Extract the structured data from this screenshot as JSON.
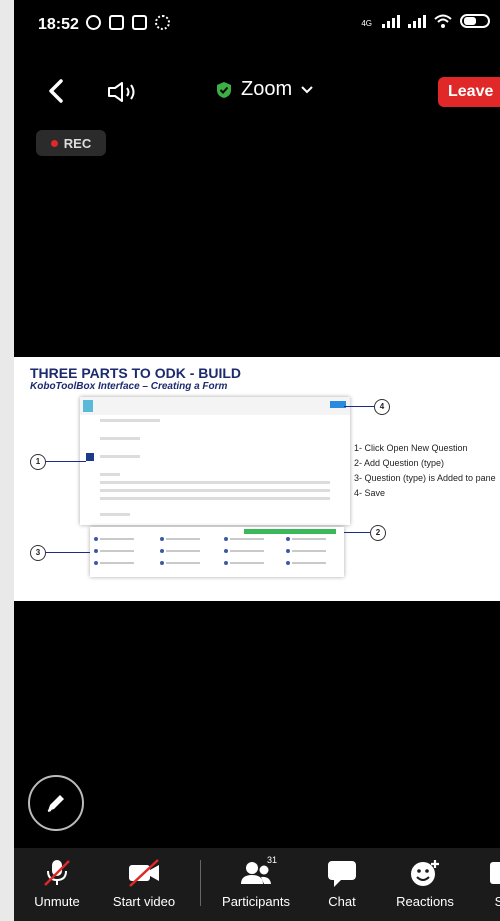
{
  "status_bar": {
    "time": "18:52",
    "network": "4G",
    "icons": [
      "alarm-icon",
      "nfc-icon",
      "upload-icon",
      "settings-icon",
      "signal-icon",
      "wifi-icon",
      "battery-icon"
    ]
  },
  "top_bar": {
    "meeting_title": "Zoom",
    "leave_label": "Leave",
    "recording_label": "REC"
  },
  "shared_slide": {
    "title": "THREE PARTS TO ODK - BUILD",
    "subtitle": "KoboToolBox Interface – Creating a Form",
    "steps": [
      "1- Click Open New Question",
      "2- Add Question (type)",
      "3- Question (type) is Added to pane",
      "4- Save"
    ],
    "callouts": [
      "1",
      "2",
      "3",
      "4"
    ]
  },
  "toolbar": {
    "items": [
      {
        "label": "Unmute",
        "icon": "muted-mic-icon"
      },
      {
        "label": "Start video",
        "icon": "video-off-icon"
      },
      {
        "label": "Participants",
        "icon": "participants-icon",
        "badge": "31"
      },
      {
        "label": "Chat",
        "icon": "chat-icon"
      },
      {
        "label": "Reactions",
        "icon": "reactions-icon"
      },
      {
        "label": "S",
        "icon": "share-icon"
      }
    ]
  },
  "colors": {
    "leave": "#e02828",
    "rec_dot": "#e02828",
    "secure_shield": "#3cb043",
    "toolbar_bg": "#1b1b1b",
    "slide_title": "#1c2a6e"
  }
}
